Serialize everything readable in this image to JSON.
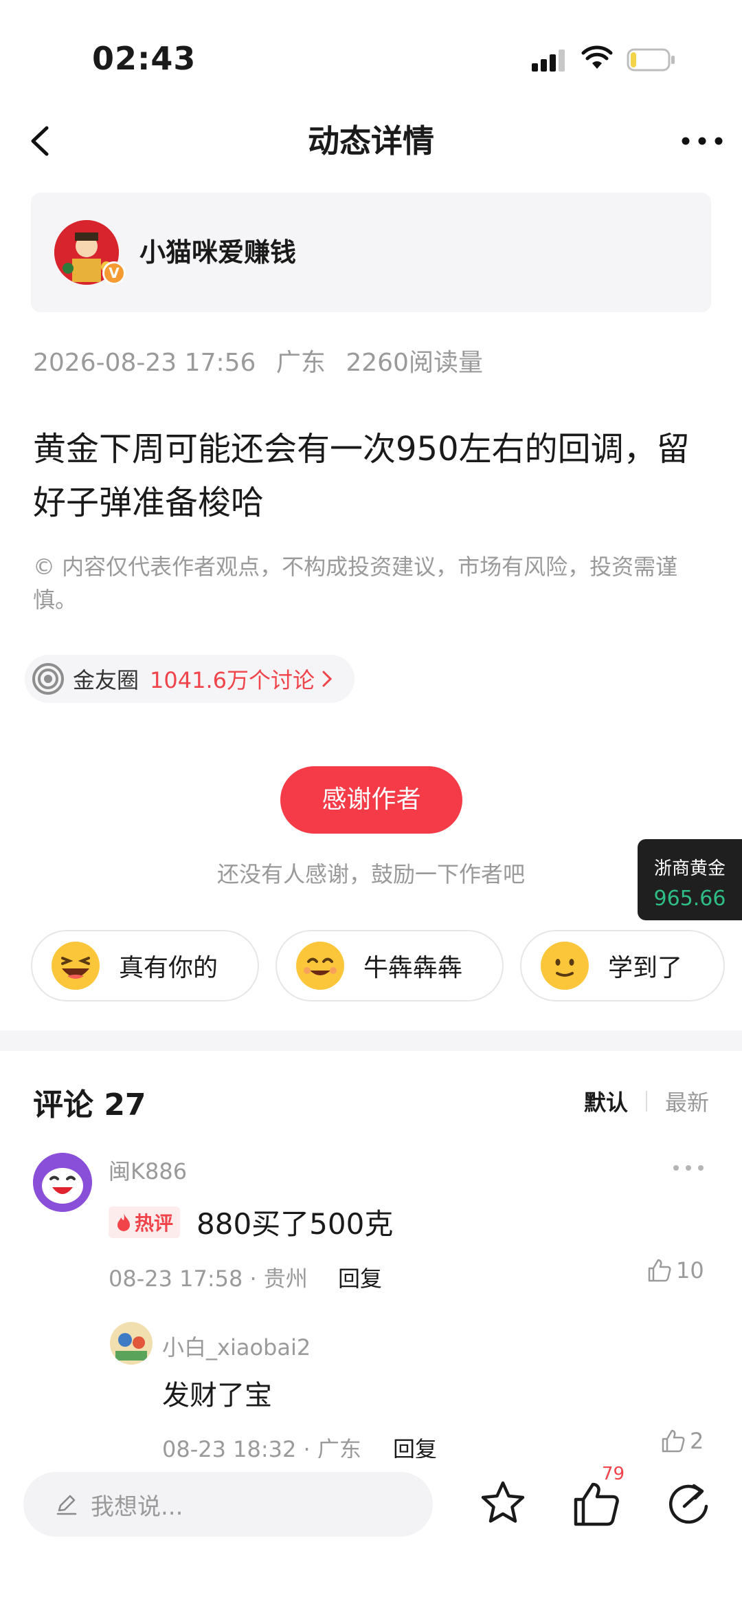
{
  "status_bar": {
    "time": "02:43"
  },
  "nav": {
    "title": "动态详情"
  },
  "author": {
    "name": "小猫咪爱赚钱",
    "badge": "V"
  },
  "post": {
    "date": "2026-08-23 17:56",
    "location": "广东",
    "reads": "2260阅读量",
    "body": "黄金下周可能还会有一次950左右的回调，留好子弹准备梭哈",
    "disclaimer": "© 内容仅代表作者观点，不构成投资建议，市场有风险，投资需谨慎。"
  },
  "circle": {
    "name": "金友圈",
    "count": "1041.6万个讨论"
  },
  "thanks": {
    "button": "感谢作者",
    "hint": "还没有人感谢，鼓励一下作者吧"
  },
  "ticker": {
    "name": "浙商黄金",
    "price": "965.66",
    "price_color": "#2ebd85"
  },
  "reactions": [
    {
      "label": "真有你的",
      "icon": "laughing-emoji-icon"
    },
    {
      "label": "牛犇犇犇",
      "icon": "smiling-emoji-icon"
    },
    {
      "label": "学到了",
      "icon": "slight-smile-emoji-icon"
    }
  ],
  "comments": {
    "title": "评论 27",
    "sort_default": "默认",
    "sort_newest": "最新",
    "items": [
      {
        "user": "闽K886",
        "tag": "热评",
        "text": "880买了500克",
        "meta": "08-23 17:58 · 贵州",
        "reply": "回复",
        "likes": "10",
        "replies": [
          {
            "user": "小白_xiaobai2",
            "text": "发财了宝",
            "meta": "08-23 18:32 · 广东",
            "reply": "回复",
            "likes": "2"
          }
        ]
      }
    ]
  },
  "bottom_bar": {
    "placeholder": "我想说...",
    "like_count": "79"
  },
  "colors": {
    "accent": "#f53b47",
    "hot": "#f0434a",
    "muted": "#9a9a9a"
  }
}
